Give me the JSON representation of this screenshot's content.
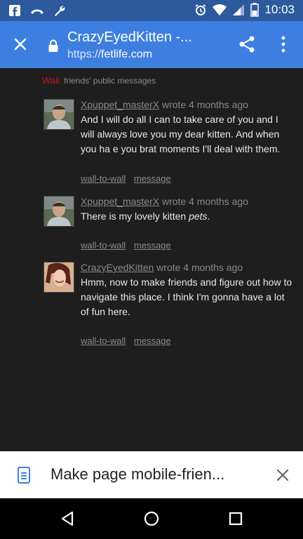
{
  "status_bar": {
    "time": "10:03",
    "icons": [
      "facebook-icon",
      "voicemail-icon",
      "wrench-icon",
      "alarm-icon",
      "wifi-icon",
      "signal-icon",
      "battery-icon"
    ]
  },
  "app_bar": {
    "title": "CrazyEyedKitten -...",
    "url_scheme": "https://",
    "url_host": "fetlife.com"
  },
  "wall": {
    "label": "Wall",
    "subtitle": "friends' public messages"
  },
  "posts": [
    {
      "author": "Xpuppet_masterX",
      "meta": "wrote 4 months ago",
      "body": "And I will do all I can to take care of you and I will always love you my dear kitten. And when you ha e you brat moments I'll deal with them.",
      "body_emphasis": "",
      "action_wall": "wall-to-wall",
      "action_message": "message"
    },
    {
      "author": "Xpuppet_masterX",
      "meta": "wrote 4 months ago",
      "body": "There is my lovely kitten ",
      "body_emphasis": "pets",
      "body_tail": ".",
      "action_wall": "wall-to-wall",
      "action_message": "message"
    },
    {
      "author": "CrazyEyedKitten",
      "meta": "wrote 4 months ago",
      "body": "Hmm, now to make friends and figure out how to navigate this place. I think I'm gonna have a lot of fun here.",
      "body_emphasis": "",
      "action_wall": "wall-to-wall",
      "action_message": "message"
    }
  ],
  "mobile_sheet": {
    "text": "Make page mobile-frien..."
  },
  "colors": {
    "status_bar": "#2c5a9c",
    "app_bar": "#3d7fe0",
    "content_bg": "#1e1e1e",
    "wall_red": "#c01818"
  }
}
